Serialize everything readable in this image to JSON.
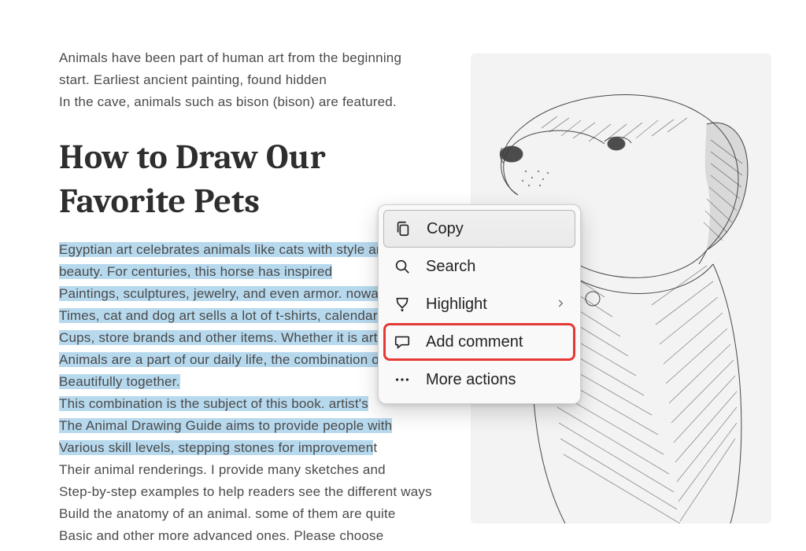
{
  "intro": {
    "line1": "Animals have been part of human art from the beginning",
    "line2": "start. Earliest ancient painting, found hidden",
    "line3": "In the cave, animals such as bison (bison) are featured."
  },
  "heading": {
    "line1": "How to Draw Our",
    "line2": "Favorite Pets"
  },
  "body": {
    "l1": "Egyptian art celebrates animals like cats with style and style",
    "l2": "beauty. For centuries, this horse has inspired",
    "l3": "Paintings, sculptures, jewelry, and even armor. nowadays",
    "l4": "Times, cat and dog art sells a lot of t-shirts, calendars, coffee",
    "l5": "Cups, store brands and other items. Whether it is art or domesticated",
    "l6": "Animals are a part of our daily life, the combination of the two is",
    "l7": "Beautifully together.",
    "l8": "This combination is the subject of this book. artist's",
    "l9": "The Animal Drawing Guide aims to provide people with",
    "l10a": "Various skill levels, stepping stones for improvemen",
    "l10b": "t",
    "l11": "Their animal renderings. I provide many sketches and",
    "l12": "Step-by-step examples to help readers see the different ways",
    "l13": "Build the anatomy of an animal. some of them are quite",
    "l14": "Basic and other more advanced ones. Please choose"
  },
  "menu": {
    "copy": "Copy",
    "search": "Search",
    "highlight": "Highlight",
    "add_comment": "Add comment",
    "more": "More actions"
  },
  "image": {
    "alt": "Pencil sketch of a dog looking left"
  }
}
